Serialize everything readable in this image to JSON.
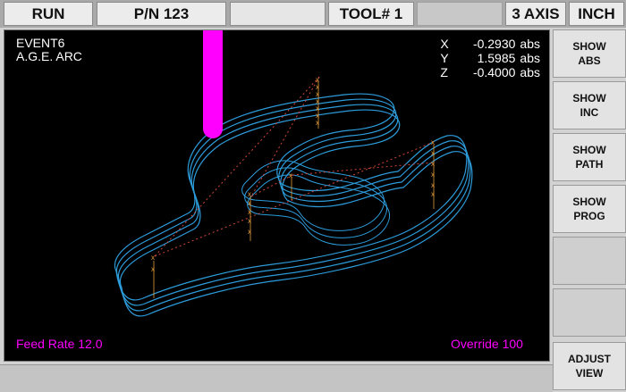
{
  "topbar": {
    "mode": "RUN",
    "part": "P/N 123",
    "blank1": "",
    "tool": "TOOL# 1",
    "blank2": "",
    "axis": "3 AXIS",
    "units": "INCH"
  },
  "viewport": {
    "event": "EVENT6",
    "operation": "A.G.E. ARC",
    "coords": [
      {
        "axis": "X",
        "value": "-0.2930",
        "unit": "abs"
      },
      {
        "axis": "Y",
        "value": "1.5985",
        "unit": "abs"
      },
      {
        "axis": "Z",
        "value": "-0.4000",
        "unit": "abs"
      }
    ],
    "feed_rate": "Feed Rate  12.0",
    "override": "Override 100",
    "colors": {
      "path": "#2d9cdb",
      "rapid": "#d0463a",
      "tool": "#ff00ff",
      "marker": "#e39b3a"
    }
  },
  "sidebar": {
    "show_abs": [
      "SHOW",
      "ABS"
    ],
    "show_inc": [
      "SHOW",
      "INC"
    ],
    "show_path": [
      "SHOW",
      "PATH"
    ],
    "show_prog": [
      "SHOW",
      "PROG"
    ],
    "adjust_view": [
      "ADJUST",
      "VIEW"
    ]
  }
}
